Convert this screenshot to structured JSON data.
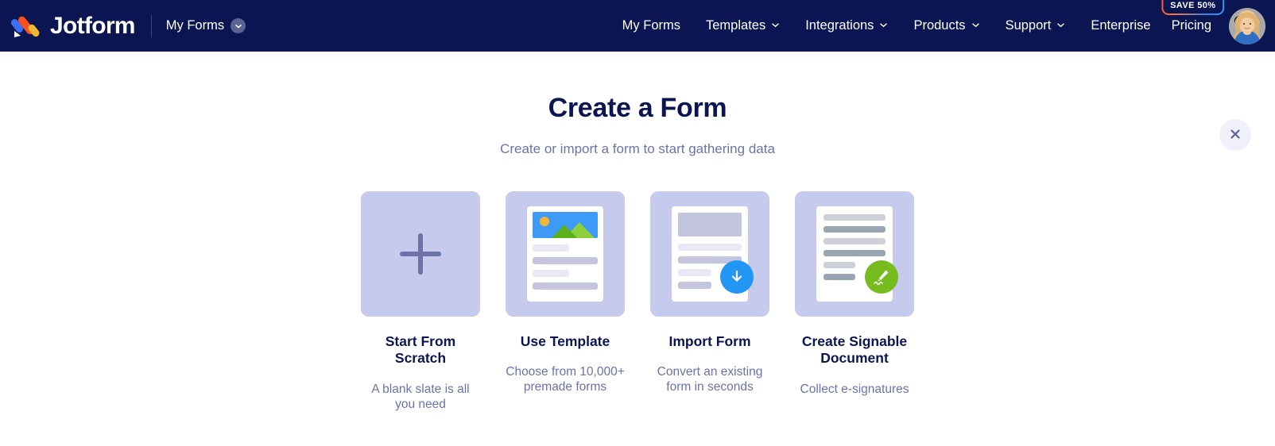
{
  "navbar": {
    "brand_name": "Jotform",
    "brand_logo_icon": "jotform-logo-icon",
    "my_forms_label": "My Forms",
    "my_forms_chevron_icon": "chevron-down-icon",
    "items": [
      {
        "label": "My Forms",
        "has_chevron": false,
        "icon": ""
      },
      {
        "label": "Templates",
        "has_chevron": true,
        "icon": "chevron-down-icon"
      },
      {
        "label": "Integrations",
        "has_chevron": true,
        "icon": "chevron-down-icon"
      },
      {
        "label": "Products",
        "has_chevron": true,
        "icon": "chevron-down-icon"
      },
      {
        "label": "Support",
        "has_chevron": true,
        "icon": "chevron-down-icon"
      },
      {
        "label": "Enterprise",
        "has_chevron": false,
        "icon": ""
      }
    ],
    "pricing_label": "Pricing",
    "save_badge_label": "SAVE 50%",
    "avatar_icon": "user-avatar",
    "background_color": "#0a1551"
  },
  "main": {
    "title": "Create a Form",
    "subtitle": "Create or import a form to start gathering data",
    "close_icon": "close-icon",
    "cards": [
      {
        "title": "Start From Scratch",
        "description": "A blank slate is all you need",
        "icon": "plus-icon"
      },
      {
        "title": "Use Template",
        "description": "Choose from 10,000+ premade forms",
        "icon": "template-document-icon"
      },
      {
        "title": "Import Form",
        "description": "Convert an existing form in seconds",
        "icon": "import-download-document-icon"
      },
      {
        "title": "Create Signable Document",
        "description": "Collect e-signatures",
        "icon": "signature-pen-document-icon"
      }
    ]
  },
  "colors": {
    "nav_background": "#0a1551",
    "title_text": "#0a1551",
    "muted_text": "#6b73a8",
    "tile_background": "#c6cbee",
    "accent_blue": "#2196f3",
    "accent_green": "#77bc1f",
    "accent_orange": "#f95b3c",
    "page_background": "#ffffff"
  }
}
